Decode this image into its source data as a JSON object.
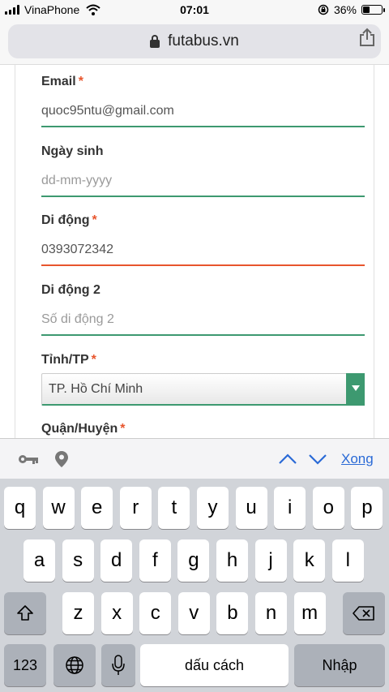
{
  "status_bar": {
    "carrier": "VinaPhone",
    "time": "07:01",
    "battery": "36%",
    "battery_level": 0.36
  },
  "browser": {
    "url": "futabus.vn"
  },
  "form": {
    "email": {
      "label": "Email",
      "required": "*",
      "value": "quoc95ntu@gmail.com"
    },
    "birthday": {
      "label": "Ngày sinh",
      "placeholder": "dd-mm-yyyy"
    },
    "phone": {
      "label": "Di động",
      "required": "*",
      "value": "0393072342"
    },
    "phone2": {
      "label": "Di động 2",
      "placeholder": "Số di động 2"
    },
    "province": {
      "label": "Tỉnh/TP",
      "required": "*",
      "value": "TP. Hồ Chí Minh"
    },
    "district": {
      "label": "Quận/Huyện",
      "required": "*"
    }
  },
  "colors": {
    "valid_line": "#3d9970",
    "error_line": "#e8552d",
    "link": "#2a6ad6"
  },
  "accessory_bar": {
    "done_label": "Xong",
    "icons": [
      "key-icon",
      "location-pin-icon",
      "chevron-up-icon",
      "chevron-down-icon"
    ]
  },
  "keyboard": {
    "row1": [
      "q",
      "w",
      "e",
      "r",
      "t",
      "y",
      "u",
      "i",
      "o",
      "p"
    ],
    "row2": [
      "a",
      "s",
      "d",
      "f",
      "g",
      "h",
      "j",
      "k",
      "l"
    ],
    "row3": [
      "z",
      "x",
      "c",
      "v",
      "b",
      "n",
      "m"
    ],
    "numbers_key": "123",
    "space_label": "dấu cách",
    "return_label": "Nhập"
  }
}
